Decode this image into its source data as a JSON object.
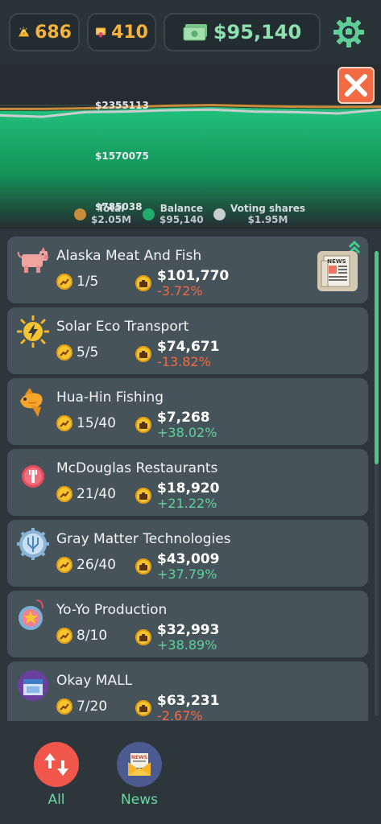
{
  "header": {
    "gold": "686",
    "gems": "410",
    "cash": "$95,140",
    "icons": {
      "gold": "gold-bars-icon",
      "gems": "gem-certificate-icon",
      "cash": "cash-icon",
      "settings": "gear-icon"
    }
  },
  "chart": {
    "labels": [
      "$2355113",
      "$1570075",
      "$785038"
    ],
    "colors": {
      "total": "#c88c3a",
      "balance": "#1fae6c",
      "voting": "#c8cdd0"
    }
  },
  "chart_data": {
    "type": "area",
    "ytick_labels": [
      "$2355113",
      "$1570075",
      "$785038"
    ],
    "series": [
      {
        "name": "Total",
        "values": [
          2300000,
          2300000,
          2310000,
          2330000,
          2350000,
          2360000,
          2345000,
          2335000,
          2330000,
          2335000
        ]
      },
      {
        "name": "Balance",
        "values": [
          2270000,
          2270000,
          2280000,
          2300000,
          2320000,
          2330000,
          2315000,
          2305000,
          2300000,
          2305000
        ]
      },
      {
        "name": "Voting shares",
        "values": [
          2200000,
          2180000,
          2250000,
          2260000,
          2280000,
          2290000,
          2260000,
          2250000,
          2230000,
          2290000
        ]
      }
    ]
  },
  "legend": [
    {
      "label": "Total",
      "value": "$2.05M",
      "color": "#c88c3a"
    },
    {
      "label": "Balance",
      "value": "$95,140",
      "color": "#1fae6c"
    },
    {
      "label": "Voting shares",
      "value": "$1.95M",
      "color": "#c8cdd0"
    }
  ],
  "companies": [
    {
      "name": "Alaska Meat And Fish",
      "shares": "1/5",
      "value": "$101,770",
      "change": "-3.72%",
      "trend": "neg",
      "icon": "pig-icon"
    },
    {
      "name": "Solar Eco Transport",
      "shares": "5/5",
      "value": "$74,671",
      "change": "-13.82%",
      "trend": "neg",
      "icon": "lightning-sun-icon"
    },
    {
      "name": "Hua-Hin Fishing",
      "shares": "15/40",
      "value": "$7,268",
      "change": "+38.02%",
      "trend": "pos",
      "icon": "fish-icon"
    },
    {
      "name": "McDouglas Restaurants",
      "shares": "21/40",
      "value": "$18,920",
      "change": "+21.22%",
      "trend": "pos",
      "icon": "restaurant-sign-icon"
    },
    {
      "name": "Gray Matter Technologies",
      "shares": "26/40",
      "value": "$43,009",
      "change": "+37.79%",
      "trend": "pos",
      "icon": "circuit-gear-icon"
    },
    {
      "name": "Yo-Yo Production",
      "shares": "8/10",
      "value": "$32,993",
      "change": "+38.89%",
      "trend": "pos",
      "icon": "yoyo-star-icon"
    },
    {
      "name": "Okay MALL",
      "shares": "7/20",
      "value": "$63,231",
      "change": "-2.67%",
      "trend": "neg",
      "icon": "mall-icon"
    }
  ],
  "news_badge": {
    "label": "NEWS"
  },
  "nav": {
    "all_label": "All",
    "news_label": "News",
    "news_icon_text": "NEWS"
  }
}
